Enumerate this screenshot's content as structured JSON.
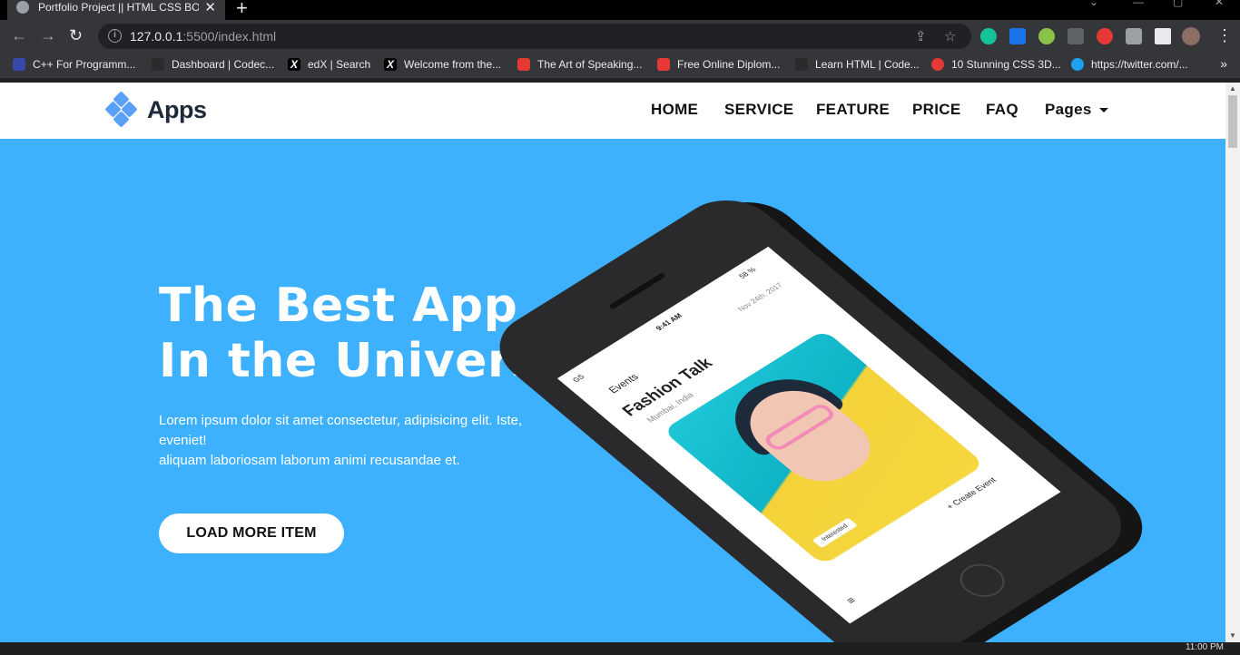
{
  "browser": {
    "tab_title": "Portfolio Project || HTML CSS BO",
    "url_host": "127.0.0.1",
    "url_rest": ":5500/index.html",
    "bookmarks": [
      {
        "label": "C++ For Programm...",
        "icon": "cpp-icon",
        "color": "#3949ab"
      },
      {
        "label": "Dashboard | Codec...",
        "icon": "codecademy-icon",
        "color": "#2b2b2b"
      },
      {
        "label": "edX | Search",
        "icon": "edx-icon",
        "color": "#000000"
      },
      {
        "label": "Welcome from the...",
        "icon": "edx-icon",
        "color": "#000000"
      },
      {
        "label": "The Art of Speaking...",
        "icon": "alison-icon",
        "color": "#e53935"
      },
      {
        "label": "Free Online Diplom...",
        "icon": "alison-icon",
        "color": "#e53935"
      },
      {
        "label": "Learn HTML | Code...",
        "icon": "codecademy-icon",
        "color": "#2b2b2b"
      },
      {
        "label": "10 Stunning CSS 3D...",
        "icon": "youtube-icon",
        "color": "#e53935"
      },
      {
        "label": "https://twitter.com/...",
        "icon": "twitter-icon",
        "color": "#1da1f2"
      }
    ]
  },
  "site": {
    "brand": "Apps",
    "nav": {
      "home": "HOME",
      "service": "SERVICE",
      "feature": "FEATURE",
      "price": "PRICE",
      "faq": "FAQ",
      "pages": "Pages"
    },
    "hero": {
      "title_line1": "The Best App",
      "title_line2": "In the Universe",
      "text_line1": "Lorem ipsum dolor sit amet consectetur, adipisicing elit. Iste, eveniet!",
      "text_line2": "aliquam laboriosam laborum animi recusandae et.",
      "button": "LOAD MORE ITEM"
    },
    "phone_screen": {
      "status": "GS",
      "time": "9:41 AM",
      "battery": "58 %",
      "section": "Events",
      "date": "Nov 24th, 2017",
      "title": "Fashion Talk",
      "location": "Mumbai, India",
      "tag": "Interested",
      "action": "+ Create Event"
    }
  },
  "colors": {
    "hero_bg": "#3eb1fe",
    "logo": "#5aa0f7",
    "chrome_dark": "#35363a"
  },
  "taskbar": {
    "clock": "11:00 PM"
  }
}
